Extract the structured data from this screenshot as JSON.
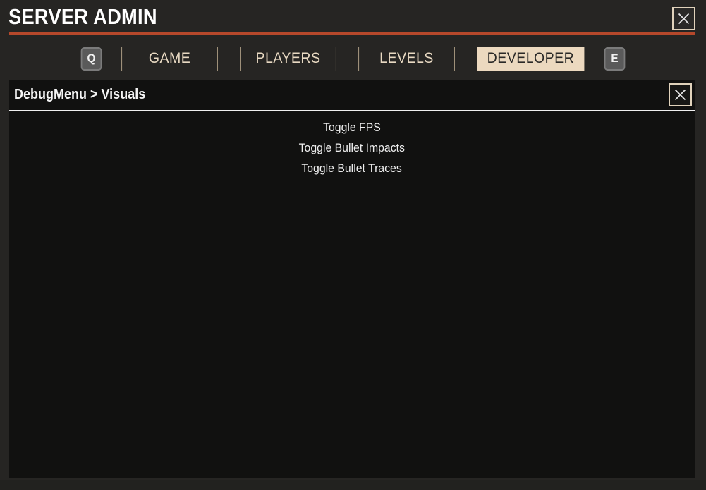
{
  "window": {
    "title": "SERVER ADMIN",
    "close_icon": "close-x-icon",
    "accent_color": "#b5482b",
    "background_color": "#262523"
  },
  "tabs": {
    "prev_key_hint": "Q",
    "next_key_hint": "E",
    "items": [
      {
        "label": "GAME",
        "active": false
      },
      {
        "label": "PLAYERS",
        "active": false
      },
      {
        "label": "LEVELS",
        "active": false
      },
      {
        "label": "DEVELOPER",
        "active": true
      }
    ],
    "active_color": "#ecd9bf",
    "border_color": "#b3a288"
  },
  "panel": {
    "breadcrumb": "DebugMenu > Visuals",
    "close_icon": "close-x-icon",
    "background_color": "#111110",
    "menu_items": [
      {
        "label": "Toggle FPS"
      },
      {
        "label": "Toggle Bullet Impacts"
      },
      {
        "label": "Toggle Bullet Traces"
      }
    ]
  }
}
